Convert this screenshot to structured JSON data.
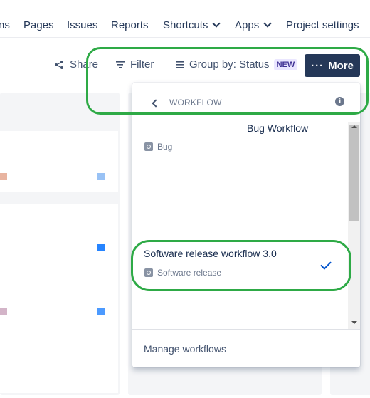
{
  "nav": {
    "items": [
      "ns",
      "Pages",
      "Issues",
      "Reports",
      "Shortcuts",
      "Apps",
      "Project settings"
    ]
  },
  "toolbar": {
    "share": "Share",
    "filter": "Filter",
    "group_by": "Group by: Status",
    "new_badge": "NEW",
    "more": "More"
  },
  "dropdown": {
    "title": "WORKFLOW",
    "info": "i",
    "workflows": [
      {
        "name": "Bug Workflow",
        "type": "Bug",
        "selected": false
      },
      {
        "name": "Software release workflow 3.0",
        "type": "Software release",
        "selected": true
      }
    ],
    "manage": "Manage workflows"
  },
  "colors": {
    "annotation": "#2eaa46",
    "more_button": "#253858",
    "check": "#0052cc"
  }
}
